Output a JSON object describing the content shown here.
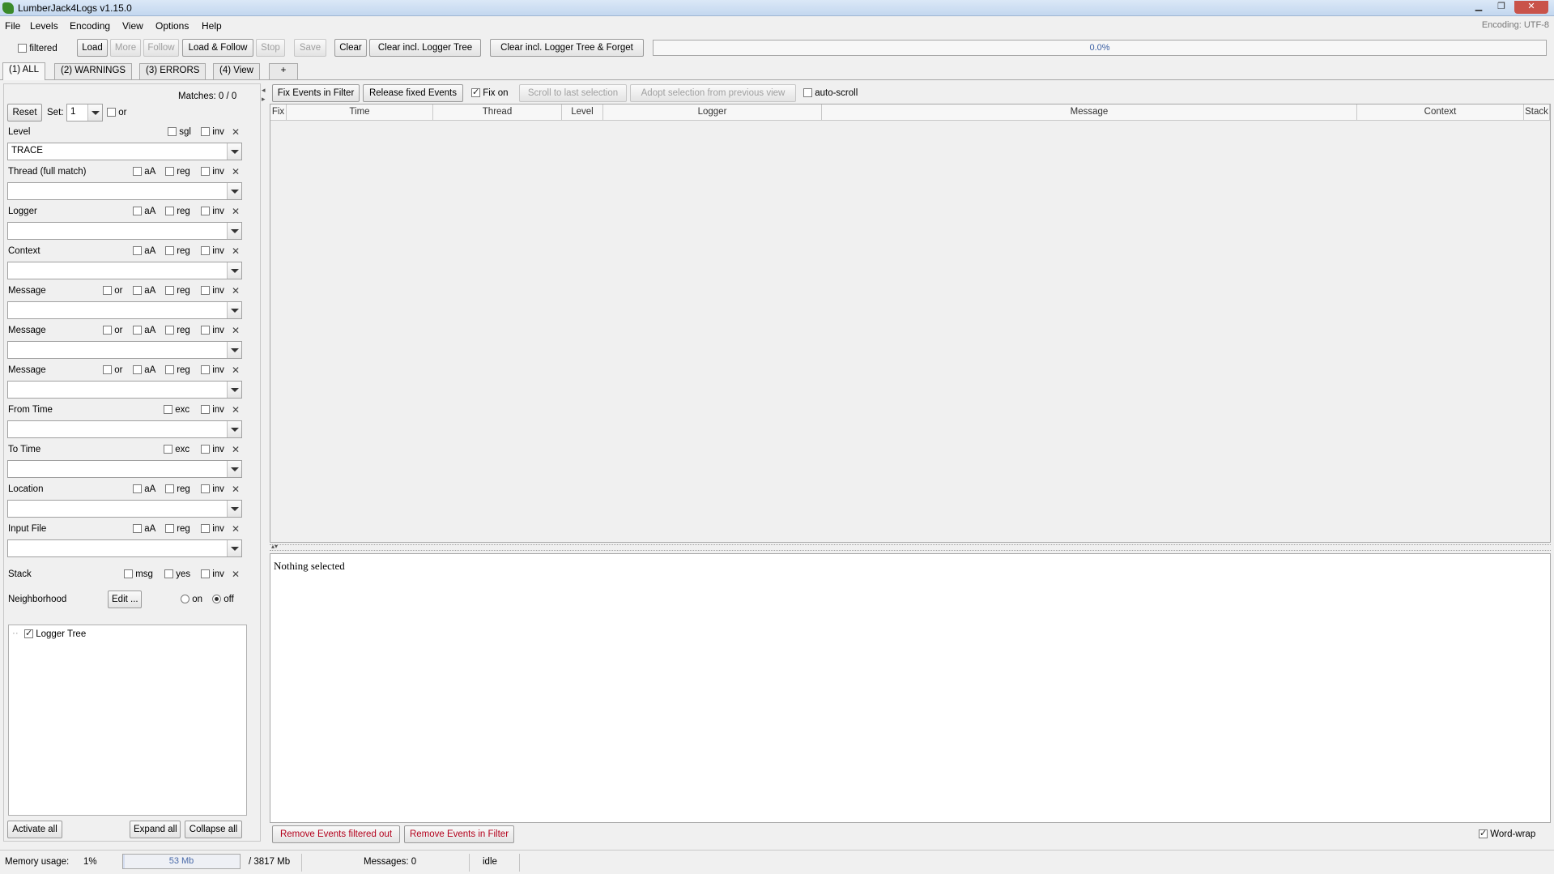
{
  "window": {
    "title": "LumberJack4Logs v1.15.0"
  },
  "menu": {
    "items": [
      "File",
      "Levels",
      "Encoding",
      "View",
      "Options",
      "Help"
    ],
    "encoding_status": "Encoding: UTF-8"
  },
  "toolbar": {
    "filtered_label": "filtered",
    "load": "Load",
    "more": "More",
    "follow": "Follow",
    "load_follow": "Load & Follow",
    "stop": "Stop",
    "save": "Save",
    "clear": "Clear",
    "clear_tree": "Clear incl. Logger Tree",
    "clear_tree_forget": "Clear incl. Logger Tree & Forget",
    "progress_text": "0.0%"
  },
  "tabs": [
    "(1) ALL",
    "(2) WARNINGS",
    "(3) ERRORS",
    "(4) View",
    "+"
  ],
  "filter": {
    "reset": "Reset",
    "set_label": "Set:",
    "set_value": "1",
    "or_label": "or",
    "matches": "Matches: 0 / 0",
    "level_label": "Level",
    "level_value": "TRACE",
    "opt_sgl": "sgl",
    "opt_inv": "inv",
    "opt_aA": "aA",
    "opt_reg": "reg",
    "opt_or": "or",
    "opt_exc": "exc",
    "opt_msg": "msg",
    "opt_yes": "yes",
    "thread_label": "Thread (full match)",
    "logger_label": "Logger",
    "context_label": "Context",
    "message_label": "Message",
    "from_time_label": "From Time",
    "to_time_label": "To Time",
    "location_label": "Location",
    "input_file_label": "Input File",
    "stack_label": "Stack",
    "neighborhood_label": "Neighborhood",
    "edit_button": "Edit ...",
    "radio_on": "on",
    "radio_off": "off",
    "tree_root": "Logger Tree",
    "activate_all": "Activate all",
    "expand_all": "Expand all",
    "collapse_all": "Collapse all"
  },
  "events_toolbar": {
    "fix_in_filter": "Fix Events in Filter",
    "release_fixed": "Release fixed Events",
    "fix_on": "Fix on",
    "scroll_last": "Scroll to last selection",
    "adopt_selection": "Adopt selection from previous view",
    "auto_scroll": "auto-scroll"
  },
  "table": {
    "columns": [
      "Fix",
      "Time",
      "Thread",
      "Level",
      "Logger",
      "Message",
      "Context",
      "Stack"
    ]
  },
  "detail": {
    "text": "Nothing selected",
    "remove_filtered_out": "Remove Events filtered out",
    "remove_in_filter": "Remove Events in Filter",
    "word_wrap": "Word-wrap"
  },
  "status": {
    "memory_label": "Memory usage:",
    "memory_percent": "1%",
    "memory_used": "53 Mb",
    "memory_fraction": 0.014,
    "memory_total": "/ 3817 Mb",
    "messages": "Messages: 0",
    "state": "idle"
  }
}
